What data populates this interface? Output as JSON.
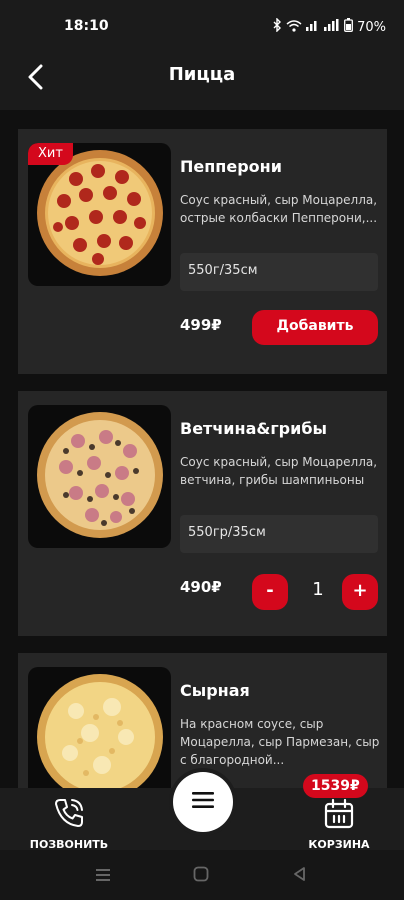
{
  "status_bar": {
    "time": "18:10",
    "battery": "70%"
  },
  "header": {
    "title": "Пицца"
  },
  "products": [
    {
      "badge": "Хит",
      "name": "Пепперони",
      "description": "Соус красный, сыр Моцарелла, острые колбаски Пепперони,...",
      "size": "550г/35см",
      "price": "499₽",
      "add_label": "Добавить"
    },
    {
      "name": "Ветчина&грибы",
      "description": "Соус красный, сыр Моцарелла, ветчина, грибы шампиньоны",
      "size": "550гр/35см",
      "price": "490₽",
      "quantity": "1",
      "minus_label": "-",
      "plus_label": "+"
    },
    {
      "name": "Сырная",
      "description": "На красном соусе, сыр Моцарелла, сыр Пармезан, сыр с благородной..."
    }
  ],
  "bottom_bar": {
    "call_label": "ПОЗВОНИТЬ",
    "cart_label": "КОРЗИНА",
    "cart_total": "1539₽"
  },
  "colors": {
    "accent": "#d4081c",
    "card": "#262626",
    "background": "#101010"
  },
  "icons": {
    "back": "arrow-left-icon",
    "call": "phone-icon",
    "menu": "hamburger-menu-icon",
    "cart": "shopping-basket-icon",
    "nav": [
      "recent-apps-icon",
      "home-icon",
      "back-triangle-icon"
    ]
  }
}
